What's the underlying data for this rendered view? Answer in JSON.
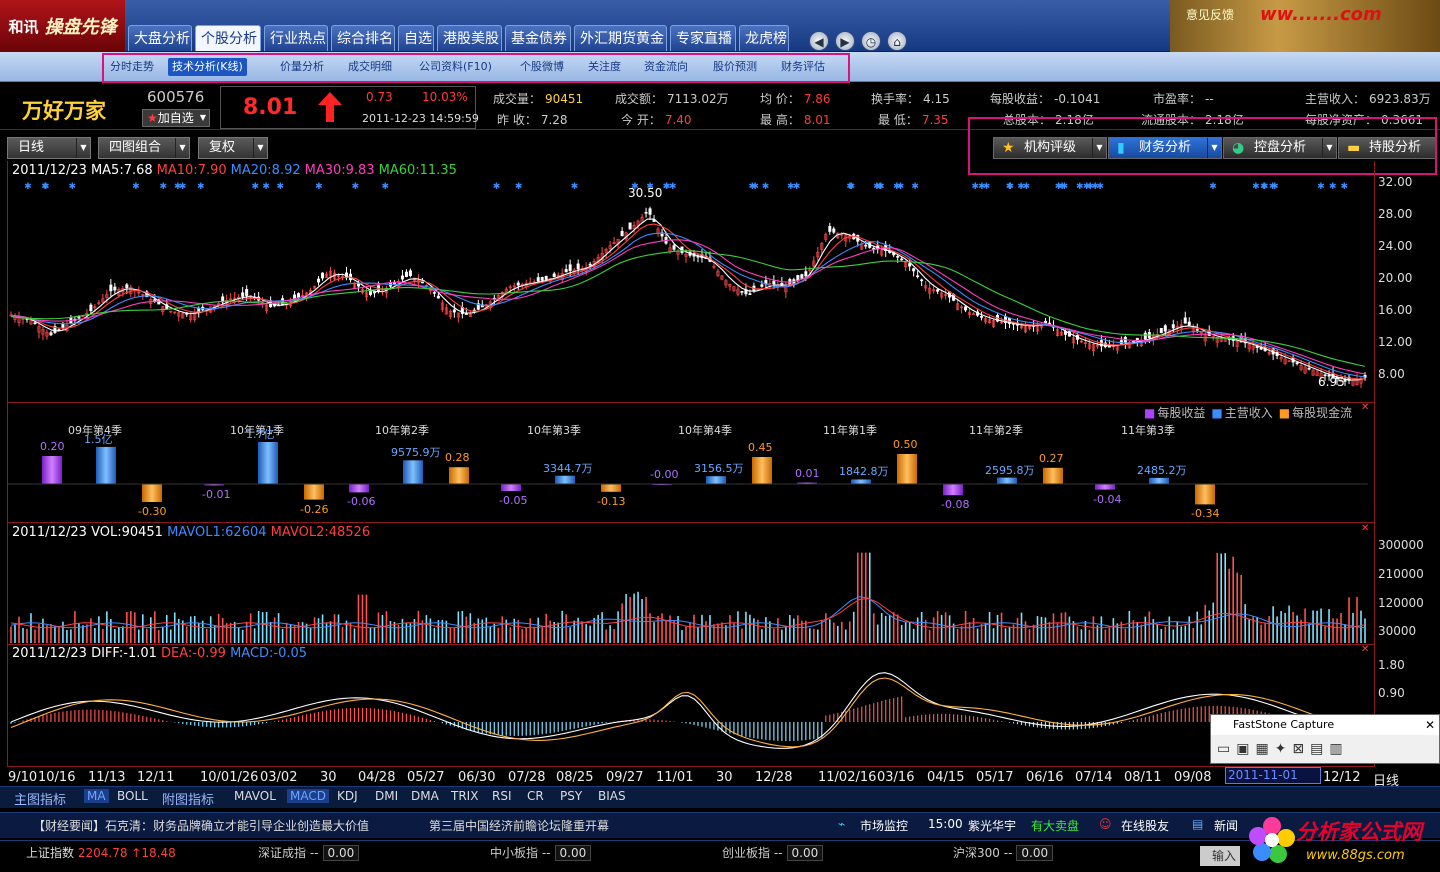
{
  "app": {
    "logo_text": "和讯",
    "logo_sub": "操盘先锋",
    "feedback": "意见反馈",
    "banner_watermark": "ww.......com"
  },
  "nav": {
    "tabs": [
      "大盘分析",
      "个股分析",
      "行业热点",
      "综合排名",
      "自选",
      "港股美股",
      "基金债券",
      "外汇期货黄金",
      "专家直播",
      "龙虎榜"
    ],
    "active": 1
  },
  "subnav": {
    "items": [
      "分时走势",
      "技术分析(K线)",
      "价量分析",
      "成交明细",
      "公司资料(F10)",
      "个股微博",
      "关注度",
      "资金流向",
      "股价预测",
      "财务评估"
    ],
    "active": 1
  },
  "quote": {
    "name": "万好万家",
    "code": "600576",
    "add_fav": "加自选",
    "price": "8.01",
    "change": "0.73",
    "change_pct": "10.03%",
    "time": "2011-12-23 14:59:59",
    "labels": {
      "volume": "成交量：",
      "prev_close": "昨  收：",
      "amount": "成交额：",
      "open": "今  开：",
      "avg": "均  价：",
      "high": "最  高：",
      "turnover": "换手率：",
      "low": "最  低：",
      "eps": "每股收益：",
      "total_shares": "总股本：",
      "pe": "市盈率：",
      "float_shares": "流通股本：",
      "revenue": "主营收入：",
      "net_assets": "每股净资产："
    },
    "values": {
      "volume": "90451",
      "prev_close": "7.28",
      "amount": "7113.02万",
      "open": "7.40",
      "avg": "7.86",
      "high": "8.01",
      "turnover": "4.15",
      "low": "7.35",
      "eps": "-0.1041",
      "total_shares": "2.18亿",
      "pe": "--",
      "float_shares": "2.18亿",
      "revenue": "6923.83万",
      "net_assets": "0.3661"
    }
  },
  "toolbar": {
    "period": "日线",
    "layout": "四图组合",
    "adjust": "复权",
    "right_buttons": [
      "机构评级",
      "财务分析",
      "控盘分析",
      "持股分析"
    ]
  },
  "main_chart": {
    "ma_date": "2011/12/23",
    "ma": [
      {
        "label": "MA5:7.68",
        "color": "#ffffff"
      },
      {
        "label": "MA10:7.90",
        "color": "#ff4040"
      },
      {
        "label": "MA20:8.92",
        "color": "#3b8cff"
      },
      {
        "label": "MA30:9.83",
        "color": "#ff3cbf"
      },
      {
        "label": "MA60:11.35",
        "color": "#3cd03c"
      }
    ],
    "y_ticks": [
      "32.00",
      "28.00",
      "24.00",
      "20.00",
      "16.00",
      "12.00",
      "8.00"
    ],
    "high_label": "30.50",
    "low_label": "6.95"
  },
  "chart_data": [
    {
      "type": "line",
      "title": "",
      "x": [
        0,
        1,
        2,
        3,
        4,
        5,
        6,
        7,
        8,
        9,
        10,
        11,
        12,
        13,
        14,
        15,
        16,
        17,
        18,
        19,
        20,
        21,
        22,
        23,
        24,
        25,
        26,
        27,
        28,
        29,
        30,
        31,
        32,
        33,
        34,
        35,
        36,
        37,
        38,
        39,
        40,
        41,
        42,
        43,
        44,
        45,
        46,
        47,
        48,
        49,
        50,
        51,
        52,
        53,
        54,
        55,
        56,
        57,
        58,
        59,
        60,
        61,
        62,
        63,
        64,
        65,
        66,
        67,
        68
      ],
      "series": [
        {
          "values": [
            15.5,
            14.8,
            13.0,
            14.5,
            16.0,
            18.5,
            19.0,
            17.5,
            16.0,
            15.5,
            16.5,
            17.5,
            18.0,
            16.5,
            17.0,
            18.5,
            21.0,
            20.0,
            18.0,
            19.0,
            20.5,
            19.0,
            16.0,
            15.5,
            17.0,
            19.0,
            19.5,
            20.0,
            21.0,
            21.5,
            24.0,
            26.0,
            28.5,
            24.0,
            23.0,
            22.5,
            19.5,
            18.0,
            19.5,
            19.0,
            20.5,
            26.0,
            25.5,
            24.0,
            23.5,
            22.0,
            19.0,
            18.0,
            16.0,
            15.0,
            14.5,
            14.0,
            14.5,
            13.0,
            12.0,
            11.5,
            12.0,
            12.5,
            13.5,
            14.5,
            13.0,
            12.5,
            12.0,
            11.0,
            10.0,
            9.0,
            8.0,
            7.2,
            7.7
          ]
        }
      ],
      "ylim": [
        6.5,
        32.5
      ]
    },
    {
      "type": "bar",
      "title": "",
      "legend": [
        "每股收益",
        "主营收入",
        "每股现金流"
      ],
      "categories": [
        "09年第4季",
        "10年第1季",
        "10年第2季",
        "10年第3季",
        "10年第4季",
        "11年第1季",
        "11年第2季",
        "11年第3季"
      ],
      "series": [
        {
          "name": "每股收益",
          "values": [
            0.2,
            -0.01,
            -0.06,
            -0.05,
            -0.0,
            0.01,
            -0.08,
            -0.04
          ]
        },
        {
          "name": "主营收入",
          "labels": [
            "1.5亿",
            "1.7亿",
            "9575.9万",
            "3344.7万",
            "3156.5万",
            "1842.8万",
            "2595.8万",
            "2485.2万"
          ],
          "values": [
            15000,
            17000,
            9575.9,
            3344.7,
            3156.5,
            1842.8,
            2595.8,
            2485.2
          ]
        },
        {
          "name": "每股现金流",
          "values": [
            -0.3,
            -0.26,
            0.28,
            -0.13,
            0.45,
            0.5,
            0.27,
            -0.34
          ]
        }
      ]
    },
    {
      "type": "bar",
      "title": "",
      "y_ticks": [
        "300000",
        "210000",
        "120000",
        "30000"
      ],
      "ylim": [
        0,
        310000
      ]
    },
    {
      "type": "line",
      "title": "",
      "y_ticks": [
        "1.80",
        "0.90"
      ]
    }
  ],
  "fin_labels": {
    "eps": [
      "0.20",
      "-0.01",
      "-0.06",
      "-0.05",
      "-0.00",
      "0.01",
      "-0.08",
      "-0.04"
    ],
    "rev": [
      "1.5亿",
      "1.7亿",
      "9575.9万",
      "3344.7万",
      "3156.5万",
      "1842.8万",
      "2595.8万",
      "2485.2万"
    ],
    "cash": [
      "-0.30",
      "-0.26",
      "0.28",
      "-0.13",
      "0.45",
      "0.50",
      "0.27",
      "-0.34"
    ]
  },
  "vol_chart": {
    "date": "2011/12/23",
    "vol": "VOL:90451",
    "mavol1": "MAVOL1:62604",
    "mavol2": "MAVOL2:48526"
  },
  "macd_chart": {
    "date": "2011/12/23",
    "diff": "DIFF:-1.01",
    "dea": "DEA:-0.99",
    "macd": "MACD:-0.05"
  },
  "x_axis": [
    "9/10",
    "10/16",
    "11/13",
    "12/11",
    "10/01/26",
    "03/02",
    "30",
    "04/28",
    "05/27",
    "06/30",
    "07/28",
    "08/25",
    "09/27",
    "11/01",
    "30",
    "12/28",
    "11/02/16",
    "03/16",
    "04/15",
    "05/17",
    "06/16",
    "07/14",
    "08/11",
    "09/08",
    "12/12",
    "日线"
  ],
  "date_input": "2011-11-01",
  "indicator_bar": {
    "main_label": "主图指标",
    "main_items": [
      "MA",
      "BOLL"
    ],
    "sub_label": "附图指标",
    "sub_items": [
      "MAVOL",
      "MACD",
      "KDJ",
      "DMI",
      "DMA",
      "TRIX",
      "RSI",
      "CR",
      "PSY",
      "BIAS"
    ]
  },
  "news": {
    "headline1": "【财经要闻】石克清：财务品牌确立才能引导企业创造最大价值",
    "headline2": "第三届中国经济前瞻论坛隆重开幕",
    "monitor": "市场监控",
    "mon_time": "15:00",
    "mon_stock": "紫光华宇",
    "mon_event": "有大卖盘",
    "friends": "在线股友",
    "newspaper": "新闻"
  },
  "status": {
    "sh_label": "上证指数",
    "sh_value": "2204.78",
    "sh_change": "18.48",
    "sz_label": "深证成指",
    "sz_value": "0.00",
    "zx_label": "中小板指",
    "zx_value": "0.00",
    "cy_label": "创业板指",
    "cy_value": "0.00",
    "hs_label": "沪深300",
    "hs_value": "0.00",
    "dash": "--",
    "input_btn": "输入"
  },
  "faststone": {
    "title": "FastStone Capture"
  },
  "watermark": {
    "site": "分析家公式网",
    "url": "www.88gs.com"
  }
}
